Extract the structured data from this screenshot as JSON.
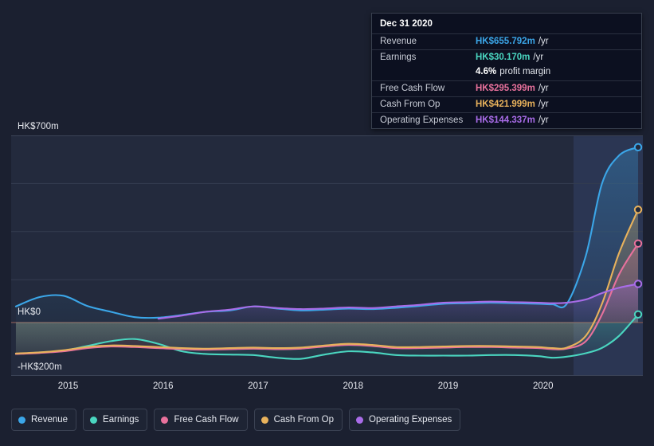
{
  "chart_data": {
    "type": "line",
    "title": "",
    "xlabel": "",
    "ylabel": "",
    "grid": true,
    "legend_position": "bottom",
    "ylim": [
      -200,
      700
    ],
    "y_ticks": [
      {
        "value": 700,
        "label": "HK$700m"
      },
      {
        "value": 0,
        "label": "HK$0"
      },
      {
        "value": -200,
        "label": "-HK$200m"
      }
    ],
    "x_ticks": [
      {
        "value": 2015,
        "label": "2015"
      },
      {
        "value": 2016,
        "label": "2016"
      },
      {
        "value": 2017,
        "label": "2017"
      },
      {
        "value": 2018,
        "label": "2018"
      },
      {
        "value": 2019,
        "label": "2019"
      },
      {
        "value": 2020,
        "label": "2020"
      }
    ],
    "xlim": [
      2014.4,
      2021.05
    ],
    "units": "HK$m",
    "series": [
      {
        "name": "Revenue",
        "color": "#3ba6e8",
        "points": [
          [
            2014.45,
            60
          ],
          [
            2014.7,
            95
          ],
          [
            2014.95,
            100
          ],
          [
            2015.2,
            62
          ],
          [
            2015.45,
            40
          ],
          [
            2015.7,
            20
          ],
          [
            2015.95,
            18
          ],
          [
            2016.2,
            28
          ],
          [
            2016.45,
            40
          ],
          [
            2016.7,
            45
          ],
          [
            2016.95,
            60
          ],
          [
            2017.2,
            52
          ],
          [
            2017.45,
            45
          ],
          [
            2017.7,
            48
          ],
          [
            2017.95,
            52
          ],
          [
            2018.2,
            50
          ],
          [
            2018.45,
            55
          ],
          [
            2018.7,
            62
          ],
          [
            2018.95,
            70
          ],
          [
            2019.2,
            72
          ],
          [
            2019.45,
            74
          ],
          [
            2019.7,
            72
          ],
          [
            2019.95,
            70
          ],
          [
            2020.1,
            68
          ],
          [
            2020.25,
            70
          ],
          [
            2020.45,
            250
          ],
          [
            2020.62,
            520
          ],
          [
            2020.8,
            625
          ],
          [
            2021.0,
            655.792
          ]
        ]
      },
      {
        "name": "Earnings",
        "color": "#4ad6c0",
        "points": [
          [
            2014.45,
            -118
          ],
          [
            2014.7,
            -112
          ],
          [
            2014.95,
            -105
          ],
          [
            2015.2,
            -88
          ],
          [
            2015.45,
            -70
          ],
          [
            2015.7,
            -62
          ],
          [
            2015.95,
            -80
          ],
          [
            2016.2,
            -108
          ],
          [
            2016.45,
            -118
          ],
          [
            2016.7,
            -120
          ],
          [
            2016.95,
            -122
          ],
          [
            2017.2,
            -132
          ],
          [
            2017.45,
            -136
          ],
          [
            2017.7,
            -120
          ],
          [
            2017.95,
            -108
          ],
          [
            2018.2,
            -112
          ],
          [
            2018.45,
            -122
          ],
          [
            2018.7,
            -124
          ],
          [
            2018.95,
            -124
          ],
          [
            2019.2,
            -124
          ],
          [
            2019.45,
            -122
          ],
          [
            2019.7,
            -122
          ],
          [
            2019.95,
            -126
          ],
          [
            2020.1,
            -132
          ],
          [
            2020.25,
            -128
          ],
          [
            2020.45,
            -115
          ],
          [
            2020.62,
            -95
          ],
          [
            2020.8,
            -50
          ],
          [
            2021.0,
            30.17
          ]
        ]
      },
      {
        "name": "Free Cash Flow",
        "color": "#e8719c",
        "points": [
          [
            2014.45,
            -118
          ],
          [
            2014.7,
            -114
          ],
          [
            2014.95,
            -108
          ],
          [
            2015.2,
            -96
          ],
          [
            2015.45,
            -90
          ],
          [
            2015.7,
            -92
          ],
          [
            2015.95,
            -96
          ],
          [
            2016.2,
            -100
          ],
          [
            2016.45,
            -102
          ],
          [
            2016.7,
            -100
          ],
          [
            2016.95,
            -98
          ],
          [
            2017.2,
            -100
          ],
          [
            2017.45,
            -98
          ],
          [
            2017.7,
            -90
          ],
          [
            2017.95,
            -84
          ],
          [
            2018.2,
            -88
          ],
          [
            2018.45,
            -96
          ],
          [
            2018.7,
            -96
          ],
          [
            2018.95,
            -94
          ],
          [
            2019.2,
            -92
          ],
          [
            2019.45,
            -92
          ],
          [
            2019.7,
            -94
          ],
          [
            2019.95,
            -96
          ],
          [
            2020.1,
            -100
          ],
          [
            2020.25,
            -98
          ],
          [
            2020.45,
            -70
          ],
          [
            2020.62,
            30
          ],
          [
            2020.8,
            180
          ],
          [
            2021.0,
            295.399
          ]
        ]
      },
      {
        "name": "Cash From Op",
        "color": "#e8b25c",
        "points": [
          [
            2014.45,
            -116
          ],
          [
            2014.7,
            -112
          ],
          [
            2014.95,
            -104
          ],
          [
            2015.2,
            -92
          ],
          [
            2015.45,
            -86
          ],
          [
            2015.7,
            -88
          ],
          [
            2015.95,
            -92
          ],
          [
            2016.2,
            -96
          ],
          [
            2016.45,
            -98
          ],
          [
            2016.7,
            -96
          ],
          [
            2016.95,
            -94
          ],
          [
            2017.2,
            -96
          ],
          [
            2017.45,
            -94
          ],
          [
            2017.7,
            -86
          ],
          [
            2017.95,
            -80
          ],
          [
            2018.2,
            -84
          ],
          [
            2018.45,
            -92
          ],
          [
            2018.7,
            -92
          ],
          [
            2018.95,
            -90
          ],
          [
            2019.2,
            -88
          ],
          [
            2019.45,
            -88
          ],
          [
            2019.7,
            -90
          ],
          [
            2019.95,
            -92
          ],
          [
            2020.1,
            -96
          ],
          [
            2020.25,
            -94
          ],
          [
            2020.45,
            -50
          ],
          [
            2020.62,
            70
          ],
          [
            2020.8,
            260
          ],
          [
            2021.0,
            421.999
          ]
        ]
      },
      {
        "name": "Operating Expenses",
        "color": "#a96ce8",
        "points": [
          [
            2015.95,
            14
          ],
          [
            2016.2,
            26
          ],
          [
            2016.45,
            40
          ],
          [
            2016.7,
            48
          ],
          [
            2016.95,
            60
          ],
          [
            2017.2,
            54
          ],
          [
            2017.45,
            50
          ],
          [
            2017.7,
            52
          ],
          [
            2017.95,
            56
          ],
          [
            2018.2,
            54
          ],
          [
            2018.45,
            60
          ],
          [
            2018.7,
            66
          ],
          [
            2018.95,
            74
          ],
          [
            2019.2,
            76
          ],
          [
            2019.45,
            78
          ],
          [
            2019.7,
            76
          ],
          [
            2019.95,
            74
          ],
          [
            2020.1,
            72
          ],
          [
            2020.25,
            74
          ],
          [
            2020.45,
            86
          ],
          [
            2020.62,
            110
          ],
          [
            2020.8,
            130
          ],
          [
            2021.0,
            144.337
          ]
        ]
      }
    ]
  },
  "tooltip": {
    "date": "Dec 31 2020",
    "rows": [
      {
        "name": "Revenue",
        "value": "HK$655.792m",
        "unit": "/yr",
        "color": "#3ba6e8"
      },
      {
        "name": "Earnings",
        "value": "HK$30.170m",
        "unit": "/yr",
        "color": "#4ad6c0",
        "sub": {
          "value": "4.6%",
          "unit": "profit margin"
        }
      },
      {
        "name": "Free Cash Flow",
        "value": "HK$295.399m",
        "unit": "/yr",
        "color": "#e8719c"
      },
      {
        "name": "Cash From Op",
        "value": "HK$421.999m",
        "unit": "/yr",
        "color": "#e8b25c"
      },
      {
        "name": "Operating Expenses",
        "value": "HK$144.337m",
        "unit": "/yr",
        "color": "#a96ce8"
      }
    ]
  },
  "legend": {
    "items": [
      {
        "label": "Revenue",
        "color": "#3ba6e8"
      },
      {
        "label": "Earnings",
        "color": "#4ad6c0"
      },
      {
        "label": "Free Cash Flow",
        "color": "#e8719c"
      },
      {
        "label": "Cash From Op",
        "color": "#e8b25c"
      },
      {
        "label": "Operating Expenses",
        "color": "#a96ce8"
      }
    ]
  },
  "colors": {
    "background": "#1b2030",
    "plot_band": "#232a3d",
    "gridline": "#2e3purpose"
  }
}
